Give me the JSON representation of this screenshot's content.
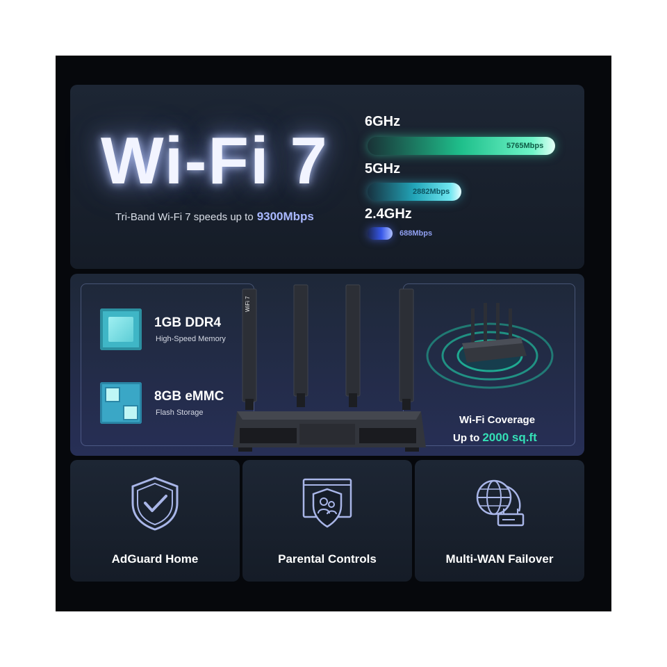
{
  "hero": {
    "title": "Wi-Fi 7",
    "tagline": "Tri-Band Wi-Fi 7 speeds up to",
    "tagline_highlight": "9300Mbps"
  },
  "bands": [
    {
      "label": "6GHz",
      "speed": "5765Mbps",
      "mbps": 5765,
      "color": "#2fd39e"
    },
    {
      "label": "5GHz",
      "speed": "2882Mbps",
      "mbps": 2882,
      "color": "#2fb6c8"
    },
    {
      "label": "2.4GHz",
      "speed": "688Mbps",
      "mbps": 688,
      "color": "#3f62f0"
    }
  ],
  "specs": {
    "memory_title": "1GB DDR4",
    "memory_sub": "High-Speed Memory",
    "storage_title": "8GB eMMC",
    "storage_sub": "Flash Storage"
  },
  "router": {
    "antenna_badge": "WiFi 7"
  },
  "coverage": {
    "title": "Wi-Fi Coverage",
    "prefix": "Up to",
    "highlight": "2000 sq.ft"
  },
  "features": [
    {
      "label": "AdGuard Home",
      "icon": "shield-check-icon"
    },
    {
      "label": "Parental Controls",
      "icon": "parental-controls-icon"
    },
    {
      "label": "Multi-WAN Failover",
      "icon": "globe-router-icon"
    }
  ],
  "colors": {
    "background": "#06080c",
    "panel": "#1a2230",
    "accent_green": "#34e0b6",
    "accent_blue": "#a9b8ff"
  }
}
